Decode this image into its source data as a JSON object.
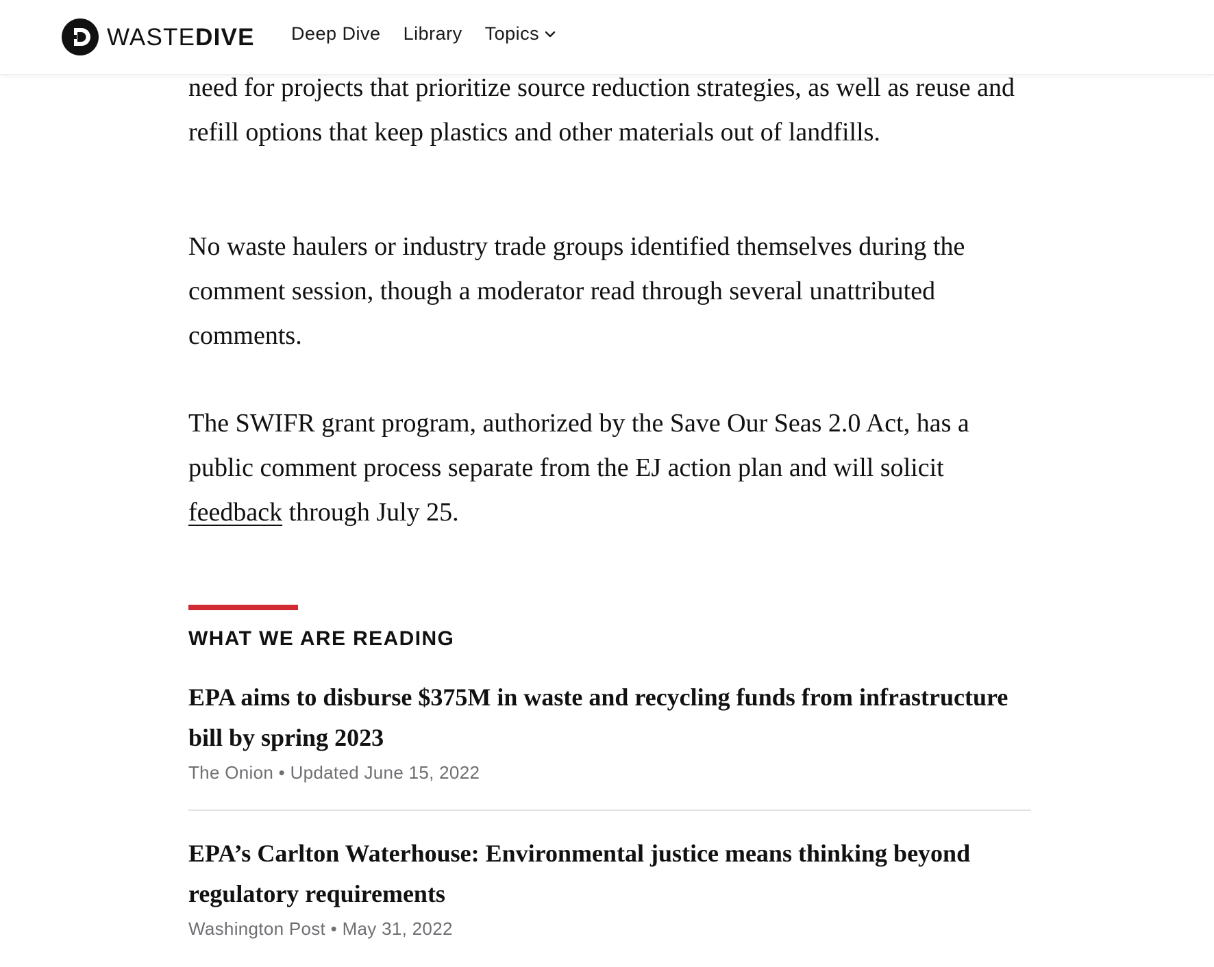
{
  "header": {
    "logo": {
      "word_light": "WASTE",
      "word_bold": "DIVE",
      "icon": "waste-dive-logo-icon"
    },
    "nav": [
      {
        "label": "Deep Dive"
      },
      {
        "label": "Library"
      },
      {
        "label": "Topics",
        "icon": "chevron-down-icon"
      }
    ]
  },
  "article": {
    "paragraph1": "need for projects that prioritize source reduction strategies, as well as reuse and refill options that keep plastics and other materials out of landfills.",
    "paragraph2": "No waste haulers or industry trade groups identified themselves during the comment session, though a moderator read through several unattributed comments.",
    "paragraph3_before": "The SWIFR grant program, authorized by the Save Our Seas 2.0 Act, has a public comment process separate from the EJ action plan and will solicit ",
    "paragraph3_link": "feedback",
    "paragraph3_after": " through July 25."
  },
  "reading": {
    "title": "WHAT WE ARE READING",
    "accent_color": "#d22a33",
    "stories": [
      {
        "title": "EPA aims to disburse $375M in waste and recycling funds from infrastructure bill by spring 2023",
        "source": "The Onion",
        "separator": "•",
        "date": "Updated June 15, 2022"
      },
      {
        "title": "EPA’s Carlton Waterhouse: Environmental justice means thinking beyond regulatory requirements",
        "source": "Washington Post",
        "separator": "•",
        "date": "May 31, 2022"
      }
    ]
  }
}
